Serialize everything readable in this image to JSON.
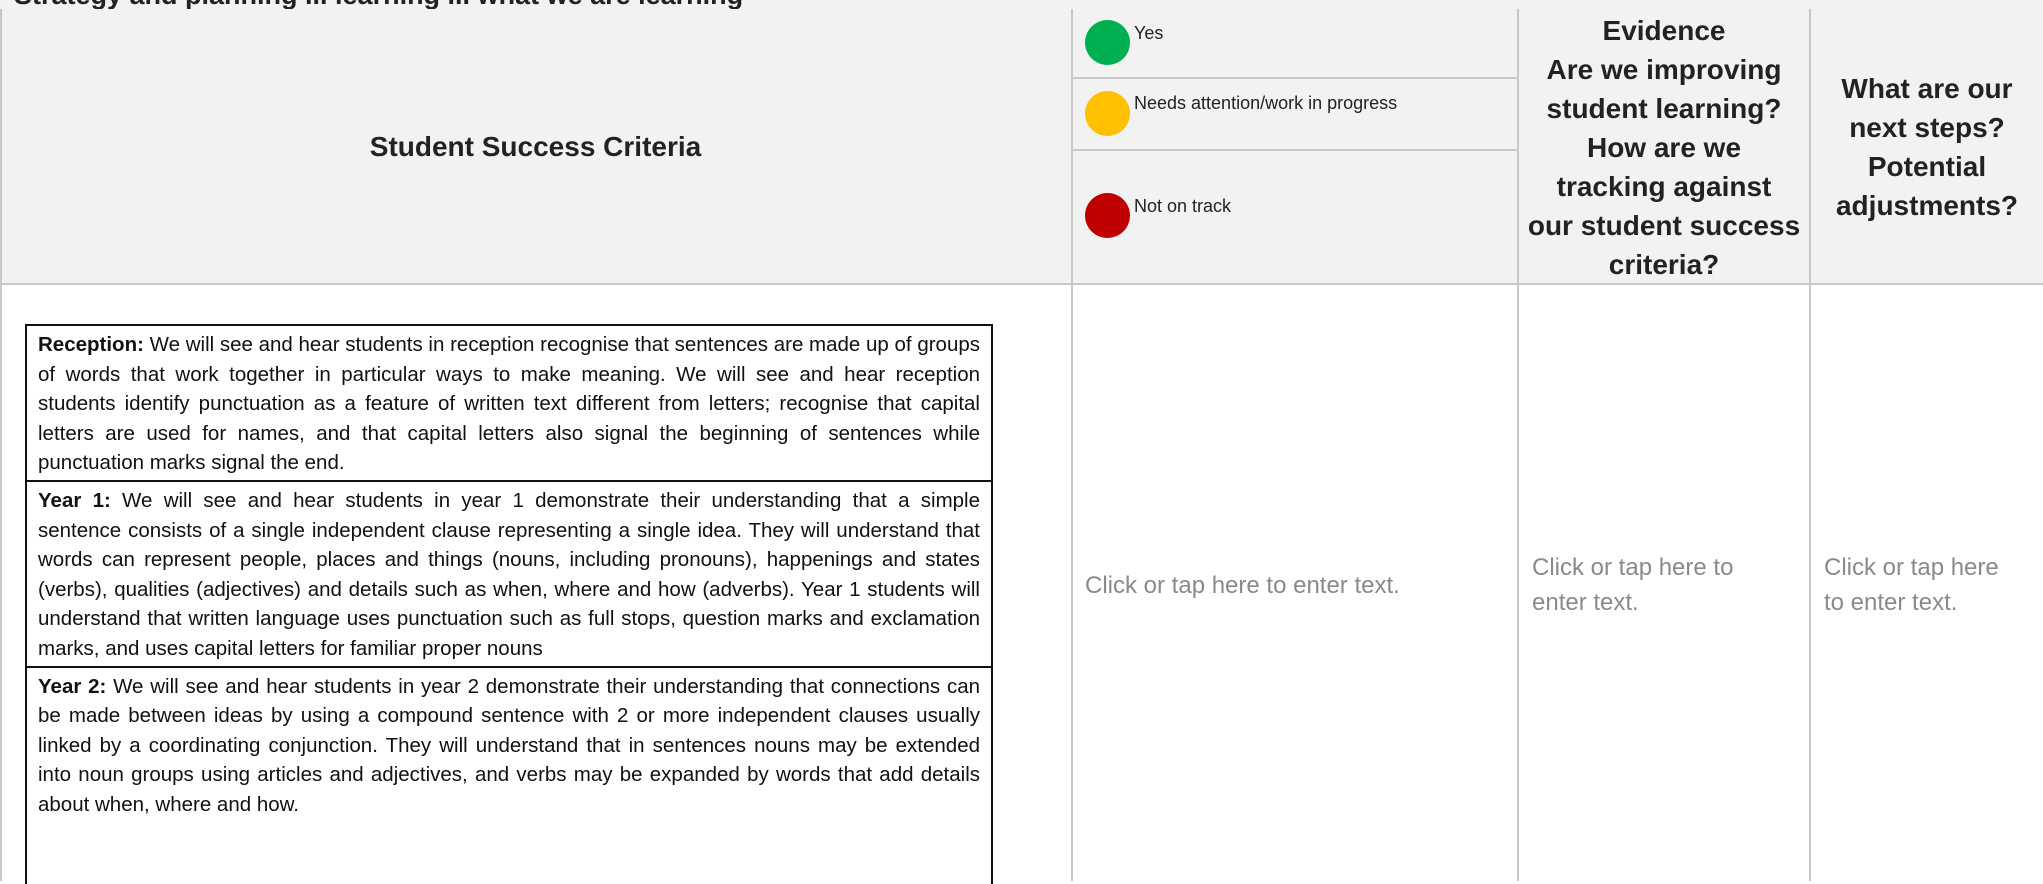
{
  "header_row": {
    "title": "Strategy and planning ... learning ... what we are learning"
  },
  "table_header": {
    "criteria_title": "Student Success Criteria",
    "legend": [
      {
        "label": "Yes",
        "color": "#00b050"
      },
      {
        "label": "Needs attention/work in progress",
        "color": "#ffc000"
      },
      {
        "label": "Not on track",
        "color": "#c00000"
      }
    ],
    "evidence": [
      "Evidence",
      "Are we improving",
      "student learning?",
      "How are we",
      "tracking against",
      "our student success",
      "criteria?"
    ],
    "next_steps": [
      "What are our",
      "next steps?",
      "Potential",
      "adjustments?"
    ]
  },
  "criteria": [
    {
      "label": "Reception:",
      "text": " We will see and hear students in reception recognise that sentences are made up of groups of words that work together in particular ways to make meaning. We will see and hear reception students identify punctuation as a feature of written text different from letters; recognise that capital letters are used for names, and that capital letters also signal the beginning of sentences while punctuation marks signal the end."
    },
    {
      "label": "Year 1:",
      "text": " We will see and hear students in year 1 demonstrate their understanding that a simple sentence consists of a single independent clause representing a single idea.  They will understand that words can represent people, places and things (nouns, including pronouns), happenings and states (verbs), qualities (adjectives) and details such as when, where and how (adverbs).  Year 1 students will understand that written language uses punctuation such as full stops, question marks and exclamation marks, and uses capital letters for familiar proper nouns"
    },
    {
      "label": "Year 2:",
      "text": " We will see and hear students in year 2 demonstrate their understanding that connections can be made between ideas by using a compound sentence with 2 or more independent clauses usually linked by a coordinating conjunction. They will understand that in sentences nouns may be extended into noun groups using articles and adjectives, and verbs may be expanded by words that add details about when, where and how."
    }
  ],
  "placeholders": {
    "status": "Click or tap here to enter text.",
    "evidence": [
      "Click or tap here to",
      "enter text."
    ],
    "next_steps": [
      "Click or tap here",
      "to enter text."
    ]
  }
}
